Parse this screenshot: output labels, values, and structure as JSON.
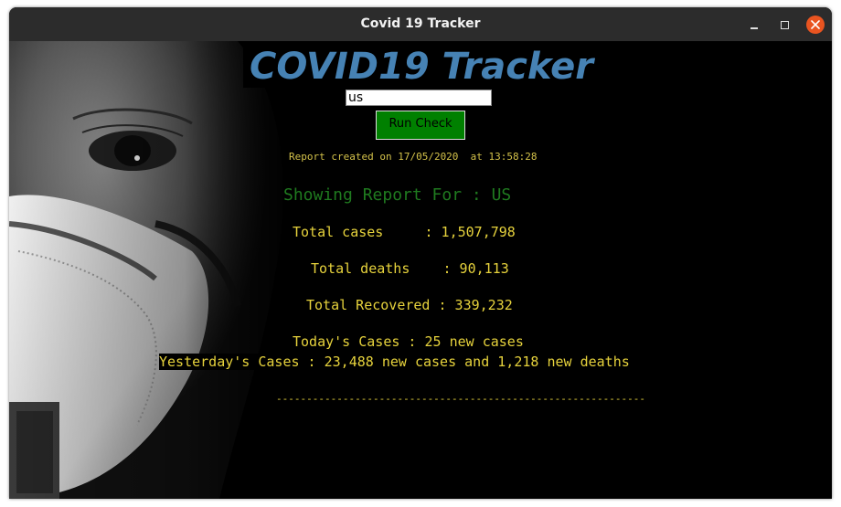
{
  "window": {
    "title": "Covid 19 Tracker"
  },
  "app": {
    "heading": "COVID19 Tracker",
    "search": {
      "value": "us"
    },
    "run_button_label": "Run Check",
    "report_created": "Report created on 17/05/2020  at 13:58:28",
    "showing": "Showing Report For : US",
    "total_cases": "Total cases     : 1,507,798",
    "total_deaths": "Total deaths    : 90,113",
    "total_recovered": "Total Recovered : 339,232",
    "todays_cases": "Today's Cases : 25 new cases",
    "yesterdays_cases": "Yesterday's Cases : 23,488 new cases and 1,218 new deaths",
    "separator": "-------------------------------------------------------------"
  },
  "colors": {
    "heading": "#4682b4",
    "button": "#008000",
    "showing": "#1f7a1f",
    "stats": "#e6d23c",
    "titlebar": "#2c2c2c",
    "close": "#e95420"
  },
  "icons": [
    "minimize-icon",
    "maximize-icon",
    "close-icon"
  ]
}
